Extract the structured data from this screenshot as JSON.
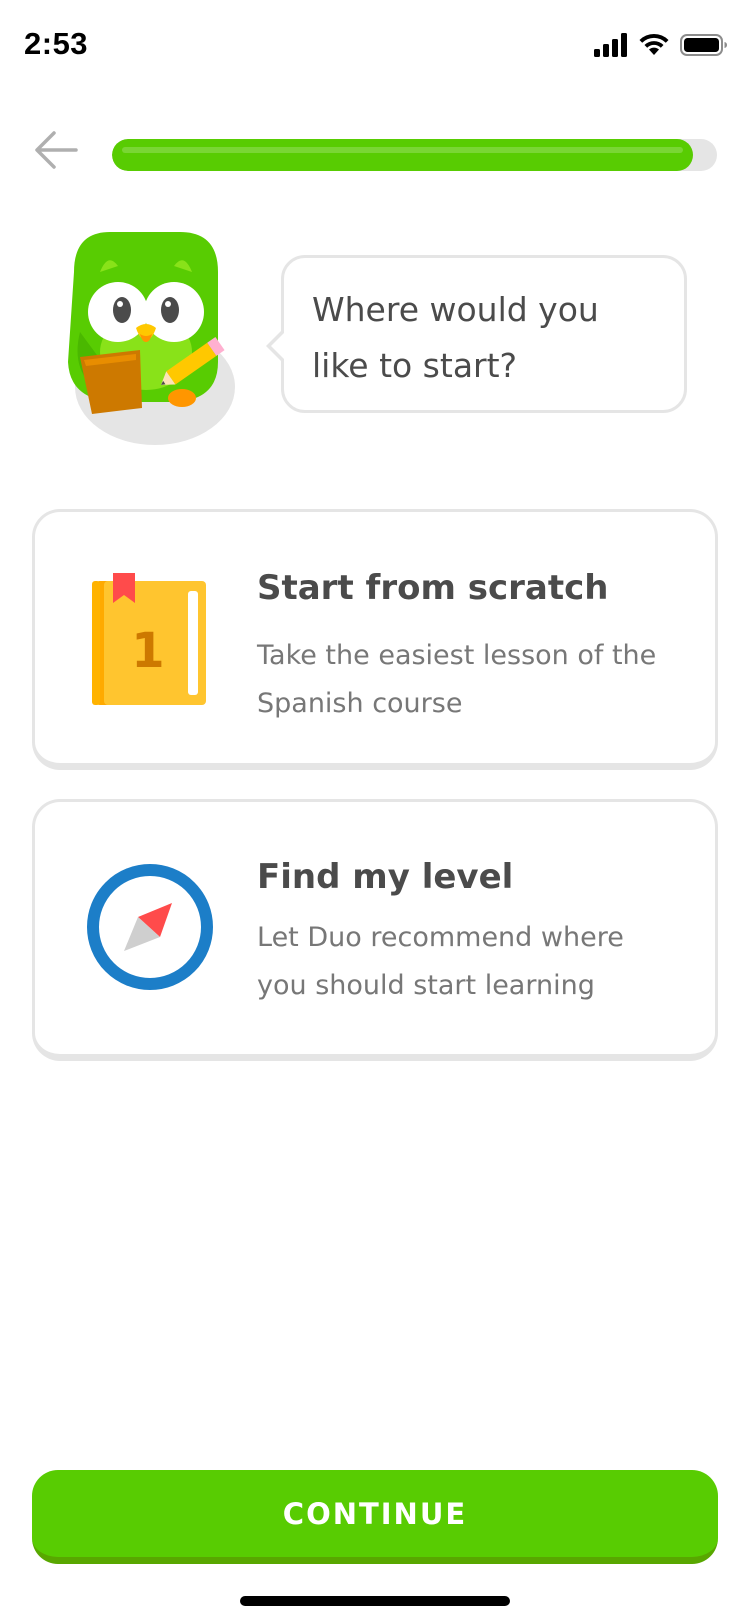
{
  "status_bar": {
    "time": "2:53",
    "icons": [
      "signal-icon",
      "wifi-icon",
      "battery-icon"
    ]
  },
  "header": {
    "back_icon": "back-arrow-icon",
    "progress": 0.96
  },
  "mascot": {
    "name": "duo-owl"
  },
  "prompt": {
    "text": "Where would you like to start?"
  },
  "options": [
    {
      "title": "Start from scratch",
      "description": "Take the easiest lesson of the Spanish course",
      "icon": "book-icon",
      "book_number": "1"
    },
    {
      "title": "Find my level",
      "description": "Let Duo recommend where you should start learning",
      "icon": "compass-icon"
    }
  ],
  "continue_label": "CONTINUE",
  "colors": {
    "brand_green": "#58cc02",
    "brand_green_dark": "#58a700",
    "border_gray": "#e5e5e5",
    "text_dark": "#4b4b4b",
    "text_muted": "#777777",
    "compass_blue": "#1c7ec8",
    "compass_red": "#ff4b4b",
    "book_yellow": "#ffc52f"
  }
}
